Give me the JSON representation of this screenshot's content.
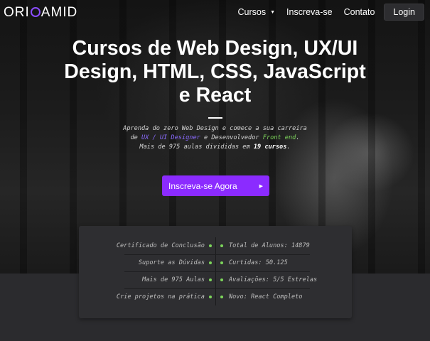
{
  "header": {
    "logo_left": "ORI",
    "logo_right": "AMID",
    "nav": {
      "cursos": "Cursos",
      "inscreva": "Inscreva-se",
      "contato": "Contato",
      "login": "Login"
    }
  },
  "hero": {
    "title": "Cursos de Web Design, UX/UI Design, HTML, CSS, JavaScript e React",
    "desc": {
      "line1": "Aprenda do zero Web Design e comece a sua carreira",
      "line2_pre": "de ",
      "ux": "UX",
      "slash": " / ",
      "ui": "UI Designer",
      "line2_mid": " e Desenvolvedor ",
      "frontend": "Front end",
      "line2_end": ".",
      "line3_pre": "Mais de 975 aulas divididas em ",
      "count": "19 cursos",
      "line3_end": "."
    },
    "cta": "Inscreva-se Agora"
  },
  "features": {
    "left": [
      "Certificado de Conclusão",
      "Suporte as Dúvidas",
      "Mais de 975 Aulas",
      "Crie projetos na prática"
    ],
    "right": [
      "Total de Alunos: 14879",
      "Curtidas: 50.125",
      "Avaliações: 5/5 Estrelas",
      "Novo: React Completo"
    ]
  },
  "colors": {
    "accent": "#8b2bff",
    "green": "#7dd65b",
    "purple_text": "#8b6bff"
  }
}
